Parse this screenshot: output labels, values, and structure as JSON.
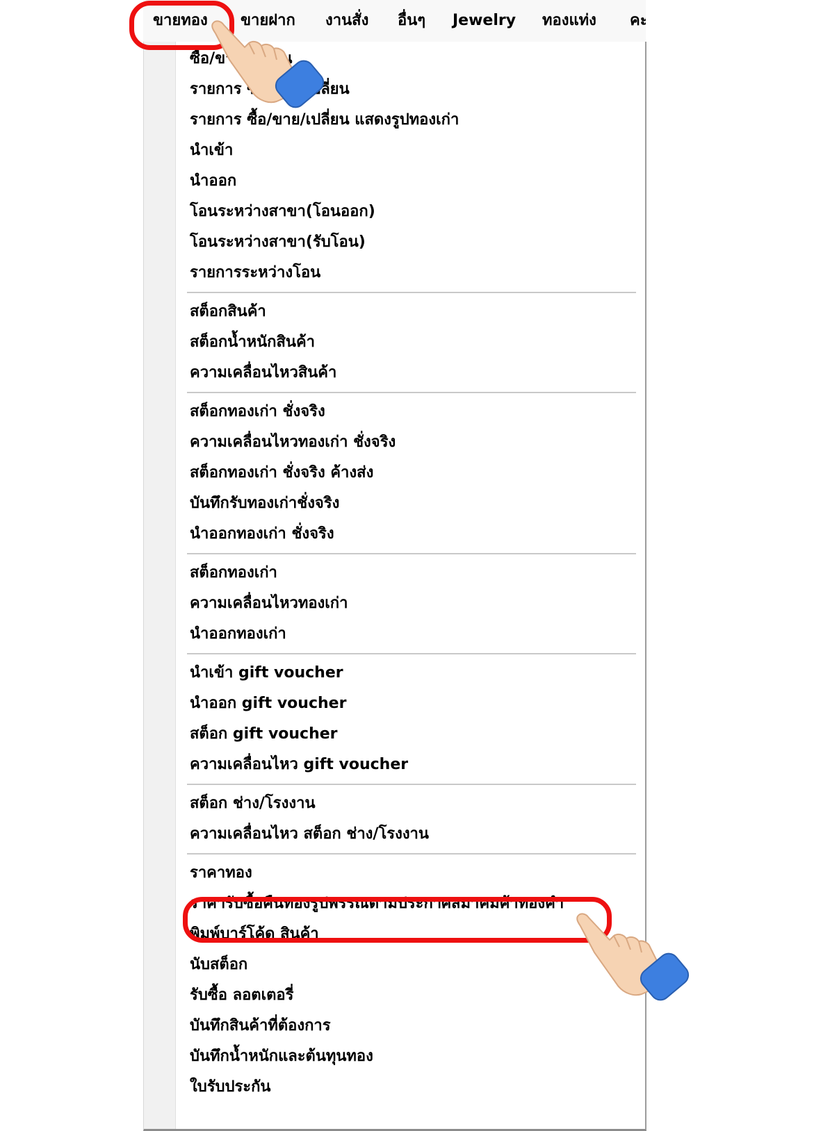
{
  "menubar": {
    "items": [
      {
        "label": "ขายทอง"
      },
      {
        "label": "ขายฝาก"
      },
      {
        "label": "งานสั่ง"
      },
      {
        "label": "อื่นๆ"
      },
      {
        "label": "Jewelry"
      },
      {
        "label": "ทองแท่ง"
      },
      {
        "label": "คะ"
      }
    ]
  },
  "dropdown": {
    "items": [
      {
        "label": "ซื้อ/ขาย/เปลี่ยน"
      },
      {
        "label": "รายการ ซื้อ/ขาย/เปลี่ยน"
      },
      {
        "label": "รายการ ซื้อ/ขาย/เปลี่ยน แสดงรูปทองเก่า"
      },
      {
        "label": "นำเข้า"
      },
      {
        "label": "นำออก"
      },
      {
        "label": "โอนระหว่างสาขา(โอนออก)"
      },
      {
        "label": "โอนระหว่างสาขา(รับโอน)"
      },
      {
        "label": "รายการระหว่างโอน"
      },
      {
        "label": "สต็อกสินค้า"
      },
      {
        "label": "สต็อกน้ำหนักสินค้า"
      },
      {
        "label": "ความเคลื่อนไหวสินค้า"
      },
      {
        "label": "สต็อกทองเก่า ชั่งจริง"
      },
      {
        "label": "ความเคลื่อนไหวทองเก่า ชั่งจริง"
      },
      {
        "label": "สต็อกทองเก่า ชั่งจริง ค้างส่ง"
      },
      {
        "label": "บันทึกรับทองเก่าชั่งจริง"
      },
      {
        "label": "นำออกทองเก่า ชั่งจริง"
      },
      {
        "label": "สต็อกทองเก่า"
      },
      {
        "label": "ความเคลื่อนไหวทองเก่า"
      },
      {
        "label": "นำออกทองเก่า"
      },
      {
        "label": "นำเข้า gift voucher"
      },
      {
        "label": "นำออก gift voucher"
      },
      {
        "label": "สต็อก gift voucher"
      },
      {
        "label": "ความเคลื่อนไหว gift voucher"
      },
      {
        "label": "สต็อก ช่าง/โรงงาน"
      },
      {
        "label": "ความเคลื่อนไหว สต็อก ช่าง/โรงงาน"
      },
      {
        "label": "ราคาทอง"
      },
      {
        "label": "ราคารับซื้อคืนทองรูปพรรณตามประกาศสมาคมค้าทองคำ"
      },
      {
        "label": "พิมพ์บาร์โค้ด สินค้า"
      },
      {
        "label": "นับสต็อก"
      },
      {
        "label": "รับซื้อ ลอตเตอรี่"
      },
      {
        "label": "บันทึกสินค้าที่ต้องการ"
      },
      {
        "label": "บันทึกน้ำหนักและต้นทุนทอง"
      },
      {
        "label": "ใบรับประกัน"
      }
    ]
  },
  "annotations": {
    "highlight_color": "#ee1010",
    "hand_skin_color": "#f6d3b3",
    "hand_cuff_color": "#3d7fe0"
  }
}
